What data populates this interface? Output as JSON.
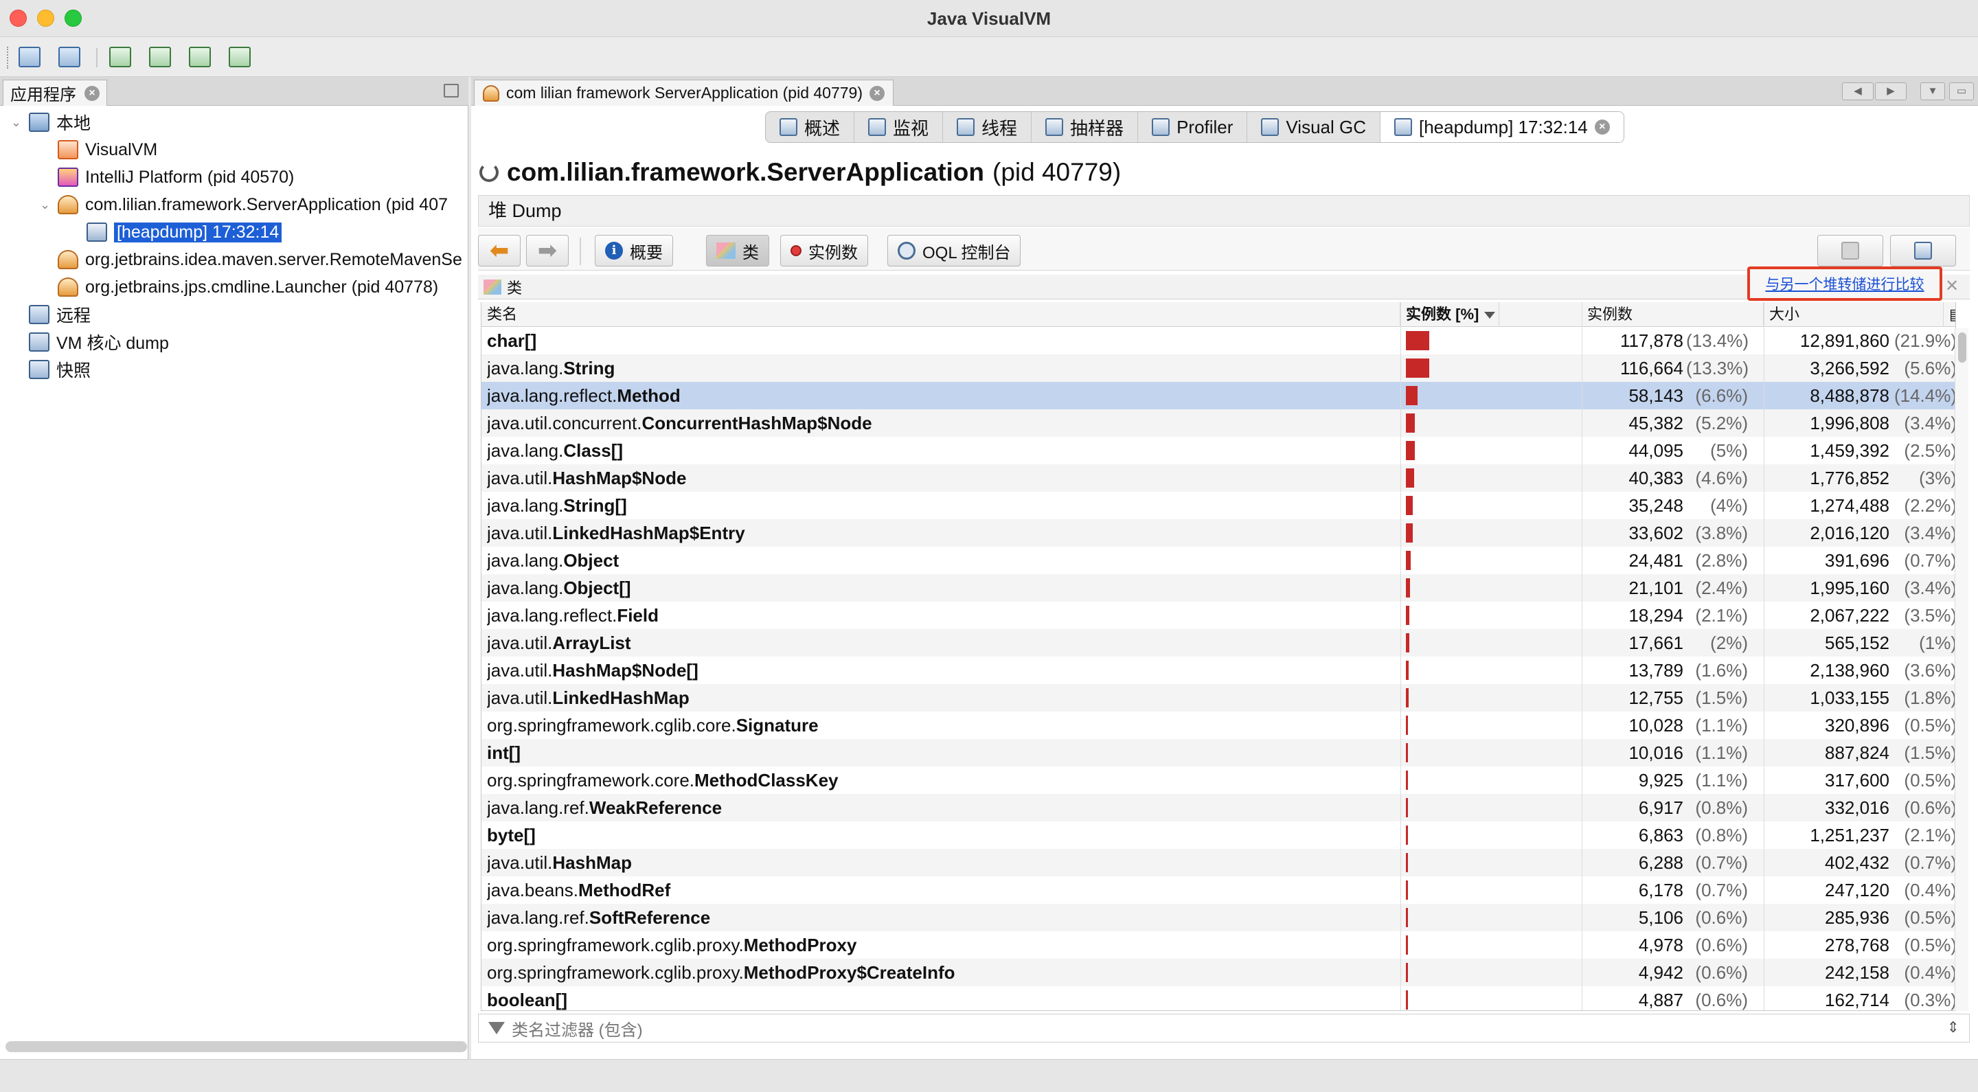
{
  "window": {
    "title": "Java VisualVM"
  },
  "toolbar": {
    "buttons": [
      "open-file-icon",
      "save-icon",
      "add-jmx-icon",
      "add-remote-icon",
      "add-coredump-icon",
      "add-snapshot-icon"
    ]
  },
  "left_panel": {
    "tab_label": "应用程序",
    "tree": [
      {
        "label": "本地",
        "level": 0,
        "icon": "computer-icon"
      },
      {
        "label": "VisualVM",
        "level": 1,
        "icon": "visualvm-icon"
      },
      {
        "label": "IntelliJ Platform (pid 40570)",
        "level": 1,
        "icon": "intellij-icon"
      },
      {
        "label": "com.lilian.framework.ServerApplication (pid 407",
        "level": 1,
        "icon": "java-app-icon"
      },
      {
        "label": "[heapdump] 17:32:14",
        "level": 2,
        "icon": "heapdump-icon",
        "selected": true
      },
      {
        "label": "org.jetbrains.idea.maven.server.RemoteMavenSe",
        "level": 1,
        "icon": "java-app-icon"
      },
      {
        "label": "org.jetbrains.jps.cmdline.Launcher (pid 40778)",
        "level": 1,
        "icon": "java-app-icon"
      },
      {
        "label": "远程",
        "level": 0,
        "icon": "remote-icon"
      },
      {
        "label": "VM 核心 dump",
        "level": 0,
        "icon": "coredump-icon"
      },
      {
        "label": "快照",
        "level": 0,
        "icon": "snapshot-icon"
      }
    ]
  },
  "right_panel": {
    "tab_label": "com lilian framework ServerApplication (pid 40779)",
    "subtabs": [
      "概述",
      "监视",
      "线程",
      "抽样器",
      "Profiler",
      "Visual GC",
      "[heapdump] 17:32:14"
    ],
    "app_title": "com.lilian.framework.ServerApplication",
    "app_pid": "(pid 40779)",
    "heap_label": "堆 Dump",
    "buttons": {
      "summary": "概要",
      "classes": "类",
      "instances": "实例数",
      "oql": "OQL 控制台"
    },
    "class_section": "类",
    "compare_link": "与另一个堆转储进行比较",
    "columns": {
      "name": "类名",
      "instances_pct": "实例数 [%]",
      "instances": "实例数",
      "size": "大小"
    },
    "filter_placeholder": "类名过滤器 (包含)",
    "accent_color": "#c62828",
    "highlight_color": "#c3d4ee"
  },
  "classes": [
    {
      "pkg": "",
      "cls": "char[]",
      "pct": 13.4,
      "count": "117,878",
      "count_pct": "(13.4%)",
      "size": "12,891,860",
      "size_pct": "(21.9%)"
    },
    {
      "pkg": "java.lang.",
      "cls": "String",
      "pct": 13.3,
      "count": "116,664",
      "count_pct": "(13.3%)",
      "size": "3,266,592",
      "size_pct": "(5.6%)"
    },
    {
      "pkg": "java.lang.reflect.",
      "cls": "Method",
      "pct": 6.6,
      "count": "58,143",
      "count_pct": "(6.6%)",
      "size": "8,488,878",
      "size_pct": "(14.4%)",
      "selected": true
    },
    {
      "pkg": "java.util.concurrent.",
      "cls": "ConcurrentHashMap$Node",
      "pct": 5.2,
      "count": "45,382",
      "count_pct": "(5.2%)",
      "size": "1,996,808",
      "size_pct": "(3.4%)"
    },
    {
      "pkg": "java.lang.",
      "cls": "Class[]",
      "pct": 5,
      "count": "44,095",
      "count_pct": "(5%)",
      "size": "1,459,392",
      "size_pct": "(2.5%)"
    },
    {
      "pkg": "java.util.",
      "cls": "HashMap$Node",
      "pct": 4.6,
      "count": "40,383",
      "count_pct": "(4.6%)",
      "size": "1,776,852",
      "size_pct": "(3%)"
    },
    {
      "pkg": "java.lang.",
      "cls": "String[]",
      "pct": 4,
      "count": "35,248",
      "count_pct": "(4%)",
      "size": "1,274,488",
      "size_pct": "(2.2%)"
    },
    {
      "pkg": "java.util.",
      "cls": "LinkedHashMap$Entry",
      "pct": 3.8,
      "count": "33,602",
      "count_pct": "(3.8%)",
      "size": "2,016,120",
      "size_pct": "(3.4%)"
    },
    {
      "pkg": "java.lang.",
      "cls": "Object",
      "pct": 2.8,
      "count": "24,481",
      "count_pct": "(2.8%)",
      "size": "391,696",
      "size_pct": "(0.7%)"
    },
    {
      "pkg": "java.lang.",
      "cls": "Object[]",
      "pct": 2.4,
      "count": "21,101",
      "count_pct": "(2.4%)",
      "size": "1,995,160",
      "size_pct": "(3.4%)"
    },
    {
      "pkg": "java.lang.reflect.",
      "cls": "Field",
      "pct": 2.1,
      "count": "18,294",
      "count_pct": "(2.1%)",
      "size": "2,067,222",
      "size_pct": "(3.5%)"
    },
    {
      "pkg": "java.util.",
      "cls": "ArrayList",
      "pct": 2,
      "count": "17,661",
      "count_pct": "(2%)",
      "size": "565,152",
      "size_pct": "(1%)"
    },
    {
      "pkg": "java.util.",
      "cls": "HashMap$Node[]",
      "pct": 1.6,
      "count": "13,789",
      "count_pct": "(1.6%)",
      "size": "2,138,960",
      "size_pct": "(3.6%)"
    },
    {
      "pkg": "java.util.",
      "cls": "LinkedHashMap",
      "pct": 1.5,
      "count": "12,755",
      "count_pct": "(1.5%)",
      "size": "1,033,155",
      "size_pct": "(1.8%)"
    },
    {
      "pkg": "org.springframework.cglib.core.",
      "cls": "Signature",
      "pct": 1.1,
      "count": "10,028",
      "count_pct": "(1.1%)",
      "size": "320,896",
      "size_pct": "(0.5%)"
    },
    {
      "pkg": "",
      "cls": "int[]",
      "pct": 1.1,
      "count": "10,016",
      "count_pct": "(1.1%)",
      "size": "887,824",
      "size_pct": "(1.5%)"
    },
    {
      "pkg": "org.springframework.core.",
      "cls": "MethodClassKey",
      "pct": 1.1,
      "count": "9,925",
      "count_pct": "(1.1%)",
      "size": "317,600",
      "size_pct": "(0.5%)"
    },
    {
      "pkg": "java.lang.ref.",
      "cls": "WeakReference",
      "pct": 0.8,
      "count": "6,917",
      "count_pct": "(0.8%)",
      "size": "332,016",
      "size_pct": "(0.6%)"
    },
    {
      "pkg": "",
      "cls": "byte[]",
      "pct": 0.8,
      "count": "6,863",
      "count_pct": "(0.8%)",
      "size": "1,251,237",
      "size_pct": "(2.1%)"
    },
    {
      "pkg": "java.util.",
      "cls": "HashMap",
      "pct": 0.7,
      "count": "6,288",
      "count_pct": "(0.7%)",
      "size": "402,432",
      "size_pct": "(0.7%)"
    },
    {
      "pkg": "java.beans.",
      "cls": "MethodRef",
      "pct": 0.7,
      "count": "6,178",
      "count_pct": "(0.7%)",
      "size": "247,120",
      "size_pct": "(0.4%)"
    },
    {
      "pkg": "java.lang.ref.",
      "cls": "SoftReference",
      "pct": 0.6,
      "count": "5,106",
      "count_pct": "(0.6%)",
      "size": "285,936",
      "size_pct": "(0.5%)"
    },
    {
      "pkg": "org.springframework.cglib.proxy.",
      "cls": "MethodProxy",
      "pct": 0.6,
      "count": "4,978",
      "count_pct": "(0.6%)",
      "size": "278,768",
      "size_pct": "(0.5%)"
    },
    {
      "pkg": "org.springframework.cglib.proxy.",
      "cls": "MethodProxy$CreateInfo",
      "pct": 0.6,
      "count": "4,942",
      "count_pct": "(0.6%)",
      "size": "242,158",
      "size_pct": "(0.4%)"
    },
    {
      "pkg": "",
      "cls": "boolean[]",
      "pct": 0.6,
      "count": "4,887",
      "count_pct": "(0.6%)",
      "size": "162,714",
      "size_pct": "(0.3%)"
    }
  ]
}
